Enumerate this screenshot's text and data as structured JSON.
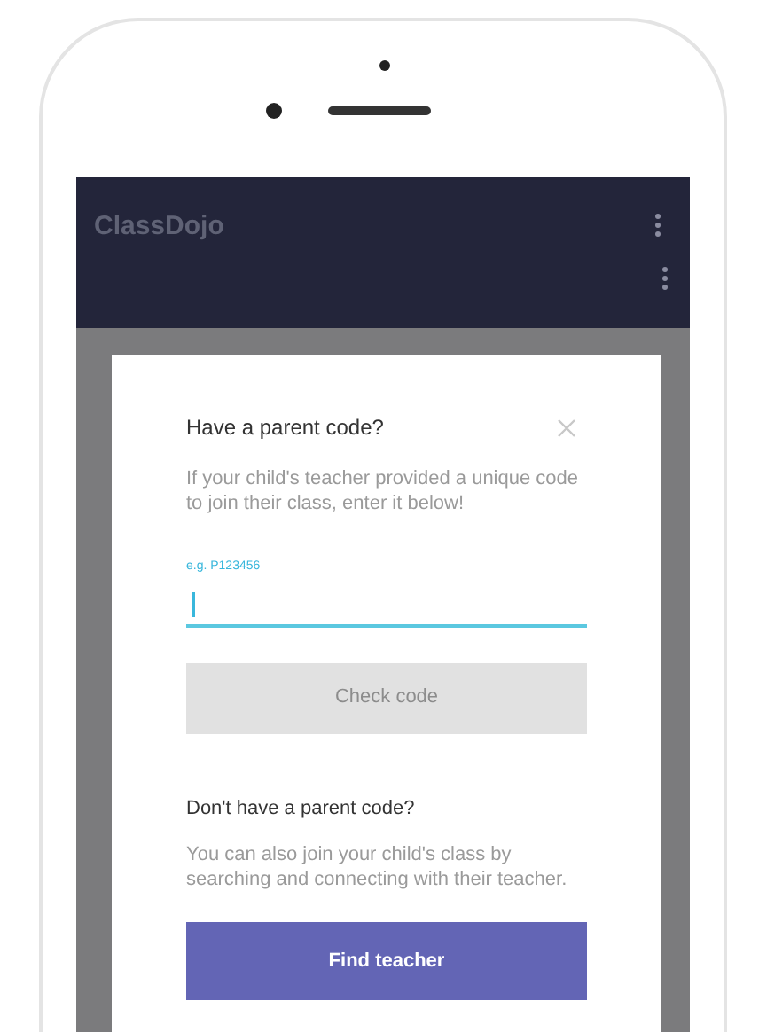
{
  "app_bar": {
    "title": "ClassDojo"
  },
  "dialog": {
    "title": "Have a parent code?",
    "description": "If your child's teacher provided a unique code to join their class, enter it below!",
    "code_field": {
      "label": "e.g. P123456",
      "focused": true
    },
    "check_button": {
      "label": "Check code",
      "disabled": true
    },
    "alt_title": "Don't have a parent code?",
    "alt_description": "You can also join your child's class by searching and connecting with their teacher.",
    "find_button": {
      "label": "Find teacher"
    }
  }
}
